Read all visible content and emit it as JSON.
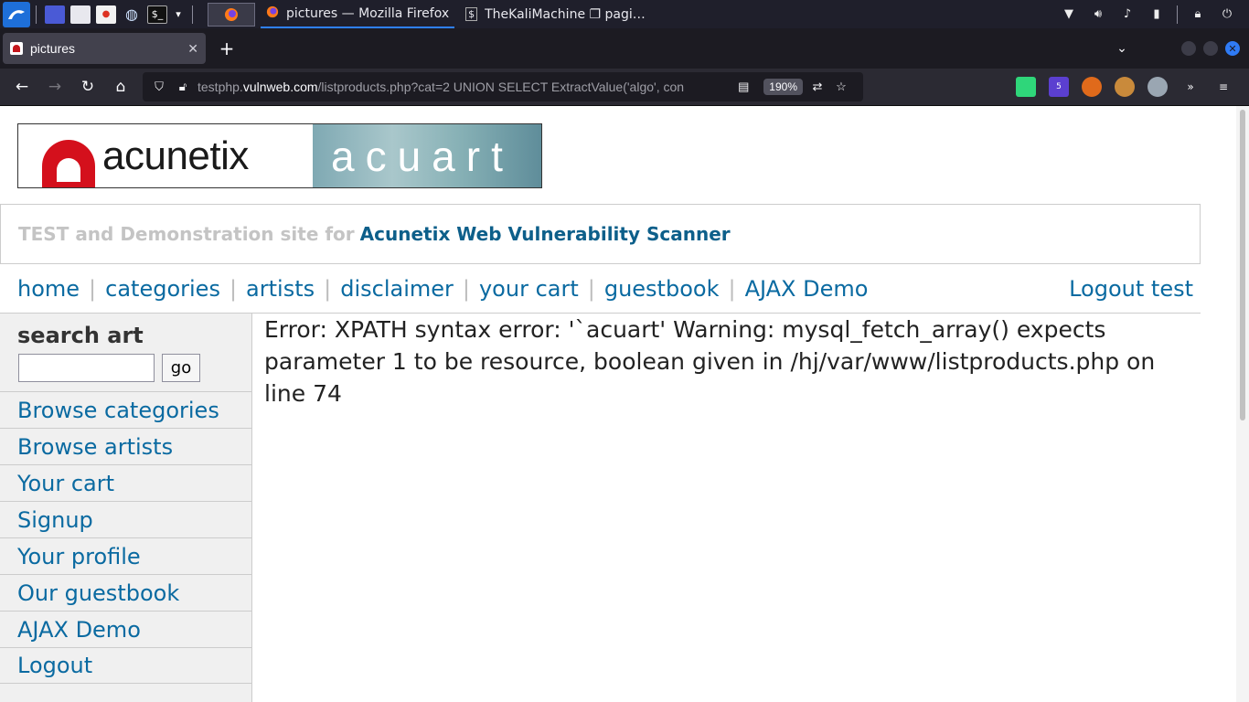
{
  "taskbar": {
    "tasks": [
      {
        "label": "pictures — Mozilla Firefox",
        "active": true
      },
      {
        "label": "TheKaliMachine ❐ pagi…",
        "active": false
      }
    ]
  },
  "browser": {
    "tab": {
      "title": "pictures"
    },
    "url": {
      "prefix": "testphp.",
      "domain": "vulnweb.com",
      "path": "/listproducts.php?cat=2 UNION SELECT ExtractValue('algo', con"
    },
    "zoom": "190%"
  },
  "site": {
    "logo": {
      "left": "acunetix",
      "right": "acuart"
    },
    "tagline": {
      "muted": "TEST and Demonstration site for",
      "brand": "Acunetix Web Vulnerability Scanner"
    },
    "topnav": {
      "home": "home",
      "categories": "categories",
      "artists": "artists",
      "disclaimer": "disclaimer",
      "your_cart": "your cart",
      "guestbook": "guestbook",
      "ajax_demo": "AJAX Demo",
      "logout": "Logout test"
    },
    "sidebar": {
      "search_title": "search art",
      "go_label": "go",
      "items": [
        {
          "label": "Browse categories"
        },
        {
          "label": "Browse artists"
        },
        {
          "label": "Your cart"
        },
        {
          "label": "Signup"
        },
        {
          "label": "Your profile"
        },
        {
          "label": "Our guestbook"
        },
        {
          "label": "AJAX Demo"
        },
        {
          "label": "Logout"
        }
      ]
    },
    "error_message": "Error: XPATH syntax error: '`acuart' Warning: mysql_fetch_array() expects parameter 1 to be resource, boolean given in /hj/var/www/listproducts.php on line 74"
  },
  "colors": {
    "link": "#0a6aa1",
    "brand_red": "#d4101c",
    "firefox_dark": "#1c1b22",
    "accent_blue": "#2f80ff"
  }
}
